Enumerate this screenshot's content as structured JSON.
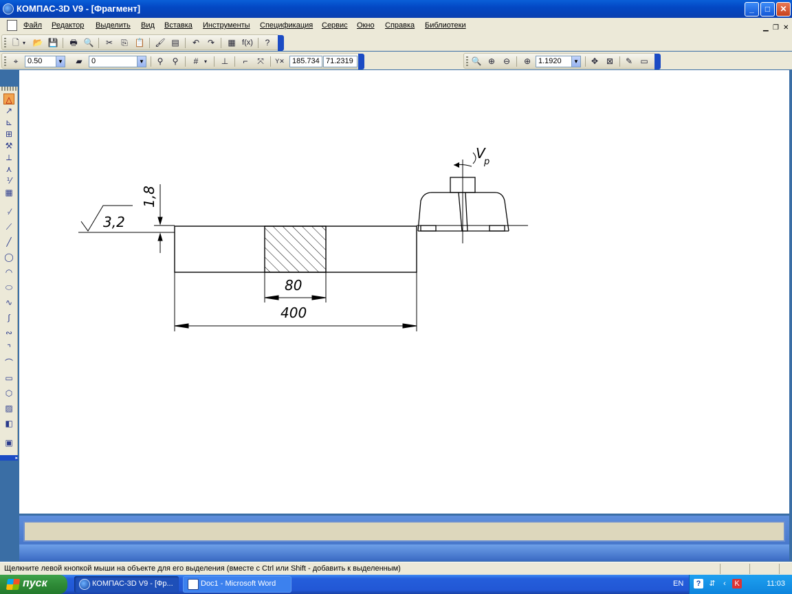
{
  "window": {
    "title": "КОМПАС-3D V9 - [Фрагмент]"
  },
  "menu": {
    "items": [
      "Файл",
      "Редактор",
      "Выделить",
      "Вид",
      "Вставка",
      "Инструменты",
      "Спецификация",
      "Сервис",
      "Окно",
      "Справка",
      "Библиотеки"
    ]
  },
  "toolbar2": {
    "step_value": "0.50",
    "layer_value": "0",
    "coord_x": "185.734",
    "coord_y": "71.2319",
    "zoom_value": "1.1920"
  },
  "drawing": {
    "roughness": "3,2",
    "depth": "1,8",
    "dim_small": "80",
    "dim_large": "400",
    "speed_label": "V",
    "speed_sub": "p"
  },
  "status": {
    "message": "Щелкните левой кнопкой мыши на объекте для его выделения (вместе с Ctrl или Shift - добавить к выделенным)"
  },
  "taskbar": {
    "start_label": "пуск",
    "tasks": [
      "КОМПАС-3D V9 - [Фр...",
      "Doc1 - Microsoft Word"
    ],
    "language": "EN",
    "clock": "11:03"
  },
  "colors": {
    "title_bar": "#0348c4",
    "taskbar": "#245edb",
    "start": "#2f8b37",
    "canvas": "#ffffff"
  }
}
